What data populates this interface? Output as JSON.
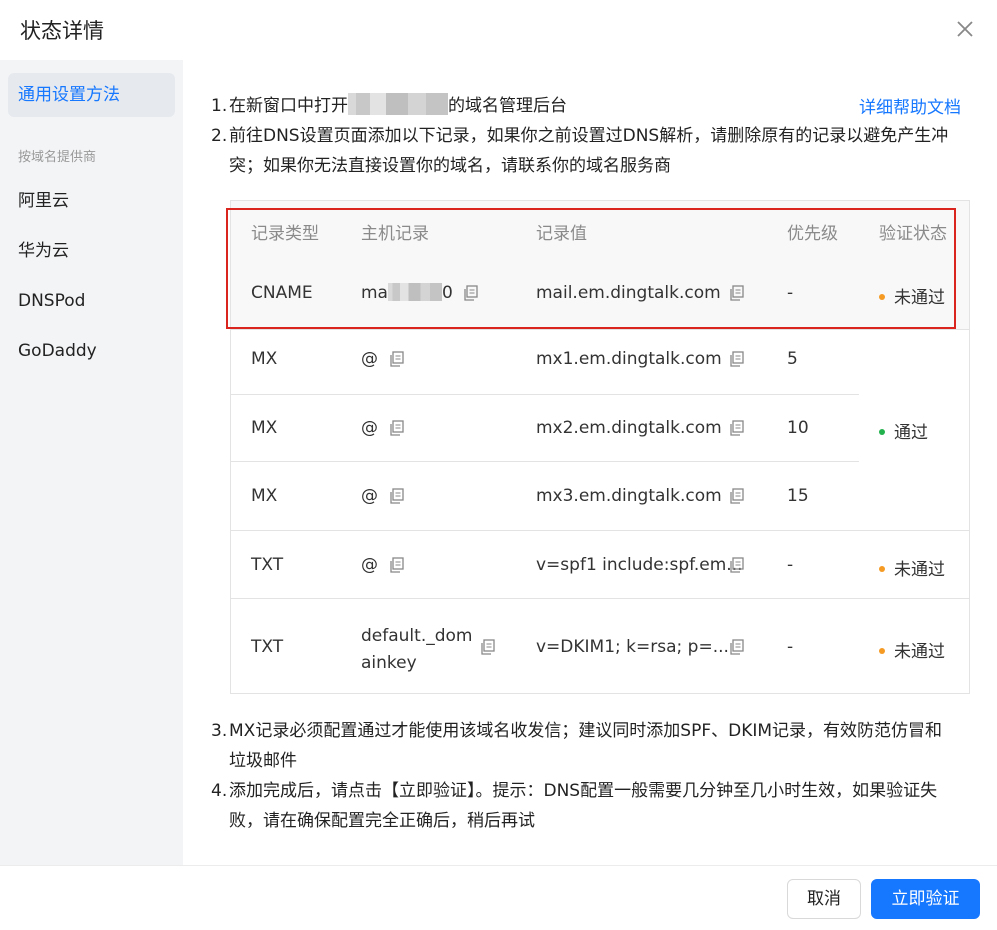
{
  "dialog": {
    "title": "状态详情"
  },
  "sidebar": {
    "general": "通用设置方法",
    "group_label": "按域名提供商",
    "providers": [
      "阿里云",
      "华为云",
      "DNSPod",
      "GoDaddy"
    ]
  },
  "steps": {
    "s1_num": "1.",
    "s1_pre": "在新窗口中打开",
    "s1_post": "的域名管理后台",
    "help_link": "详细帮助文档",
    "s2_num": "2.",
    "s2_line1": "前往DNS设置页面添加以下记录，如果你之前设置过DNS解析，请删除原有的记录以避免产生冲",
    "s2_line2": "突；如果你无法直接设置你的域名，请联系你的域名服务商",
    "s3_num": "3.",
    "s3_line1": "MX记录必须配置通过才能使用该域名收发信；建议同时添加SPF、DKIM记录，有效防范仿冒和",
    "s3_line2": "垃圾邮件",
    "s4_num": "4.",
    "s4_line1": "添加完成后，请点击【立即验证】。提示：DNS配置一般需要几分钟至几小时生效，如果验证失",
    "s4_line2": "败，请在确保配置完全正确后，稍后再试"
  },
  "table": {
    "headers": {
      "type": "记录类型",
      "host": "主机记录",
      "value": "记录值",
      "priority": "优先级",
      "status": "验证状态"
    },
    "rows": [
      {
        "type": "CNAME",
        "host_pre": "ma",
        "host_post": "0",
        "value": "mail.em.dingtalk.com",
        "priority": "-",
        "status": "未通过"
      },
      {
        "type": "MX",
        "host": "@",
        "value": "mx1.em.dingtalk.com",
        "priority": "5"
      },
      {
        "type": "MX",
        "host": "@",
        "value": "mx2.em.dingtalk.com",
        "priority": "10",
        "status": "通过"
      },
      {
        "type": "MX",
        "host": "@",
        "value": "mx3.em.dingtalk.com",
        "priority": "15"
      },
      {
        "type": "TXT",
        "host": "@",
        "value": "v=spf1 include:spf.em...",
        "priority": "-",
        "status": "未通过"
      },
      {
        "type": "TXT",
        "host_line1": "default._dom",
        "host_line2": "ainkey",
        "value": "v=DKIM1; k=rsa; p=...",
        "priority": "-",
        "status": "未通过"
      }
    ]
  },
  "footer": {
    "cancel": "取消",
    "verify": "立即验证"
  },
  "colors": {
    "accent": "#1677ff",
    "pass": "#22b14c",
    "fail": "#f59a23",
    "highlight": "#d9251d"
  },
  "icons": {
    "close": "close-icon",
    "copy": "copy-icon"
  }
}
